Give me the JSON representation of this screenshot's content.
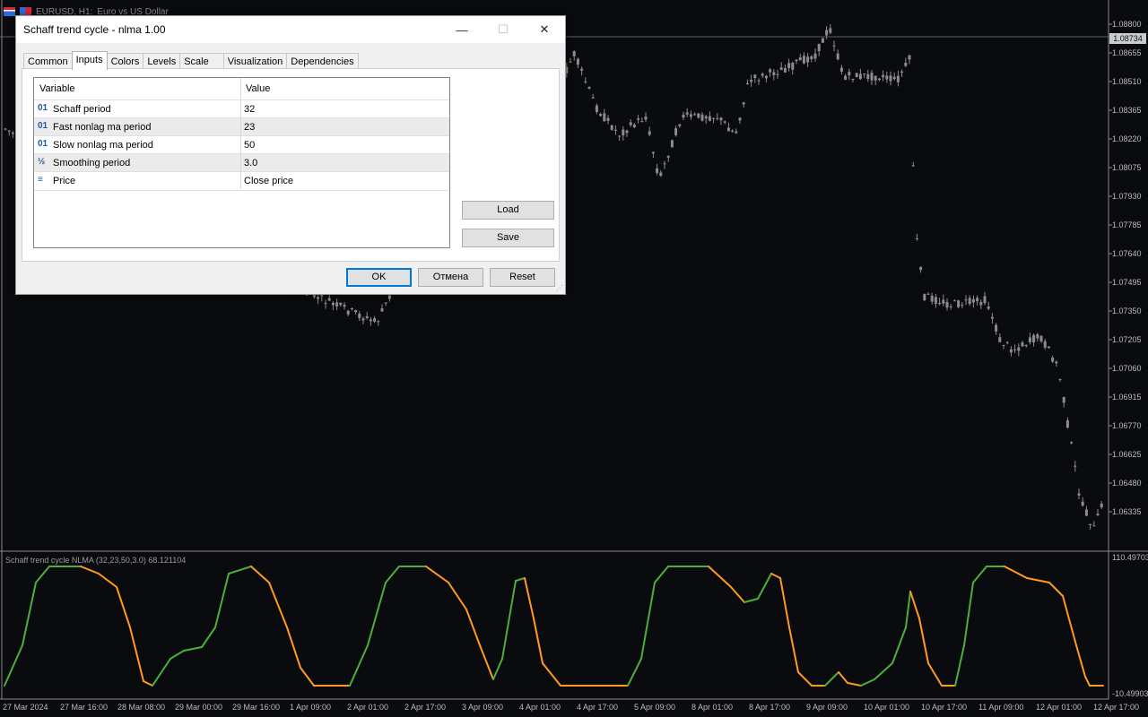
{
  "chart_header": {
    "symbol": "EURUSD, H1:",
    "description": "Euro vs US Dollar"
  },
  "price_axis": {
    "ticks": [
      "1.08800",
      "1.08655",
      "1.08510",
      "1.08365",
      "1.08220",
      "1.08075",
      "1.07930",
      "1.07785",
      "1.07640",
      "1.07495",
      "1.07350",
      "1.07205",
      "1.07060",
      "1.06915",
      "1.06770",
      "1.06625",
      "1.06480",
      "1.06335"
    ],
    "current_price": "1.08734"
  },
  "time_axis": {
    "labels": [
      "27 Mar 2024",
      "27 Mar 16:00",
      "28 Mar 08:00",
      "29 Mar 00:00",
      "29 Mar 16:00",
      "1 Apr 09:00",
      "2 Apr 01:00",
      "2 Apr 17:00",
      "3 Apr 09:00",
      "4 Apr 01:00",
      "4 Apr 17:00",
      "5 Apr 09:00",
      "8 Apr 01:00",
      "8 Apr 17:00",
      "9 Apr 09:00",
      "10 Apr 01:00",
      "10 Apr 17:00",
      "11 Apr 09:00",
      "12 Apr 01:00",
      "12 Apr 17:00"
    ]
  },
  "indicator": {
    "title": "Schaff trend cycle NLMA (32,23,50,3.0) 68.121104",
    "max_label": "110.49703",
    "min_label": "-10.49903",
    "rising_color": "#4caf3a",
    "falling_color": "#ff9a1f"
  },
  "dialog": {
    "title": "Schaff trend cycle - nlma 1.00",
    "window_buttons": {
      "minimize": "—",
      "maximize": "☐",
      "close": "✕"
    },
    "tabs": [
      "Common",
      "Inputs",
      "Colors",
      "Levels",
      "Scale",
      "Visualization",
      "Dependencies"
    ],
    "active_tab": "Inputs",
    "grid": {
      "headers": {
        "variable": "Variable",
        "value": "Value"
      },
      "rows": [
        {
          "icon": "01",
          "icon_name": "integer-icon",
          "name": "Schaff period",
          "value": "32"
        },
        {
          "icon": "01",
          "icon_name": "integer-icon",
          "name": "Fast nonlag ma period",
          "value": "23"
        },
        {
          "icon": "01",
          "icon_name": "integer-icon",
          "name": "Slow nonlag ma period",
          "value": "50"
        },
        {
          "icon": "½",
          "icon_name": "double-icon",
          "name": "Smoothing period",
          "value": "3.0"
        },
        {
          "icon": "≡",
          "icon_name": "enum-icon",
          "name": "Price",
          "value": "Close price"
        }
      ]
    },
    "side_buttons": {
      "load": "Load",
      "save": "Save"
    },
    "footer_buttons": {
      "ok": "OK",
      "cancel": "Отмена",
      "reset": "Reset"
    }
  }
}
